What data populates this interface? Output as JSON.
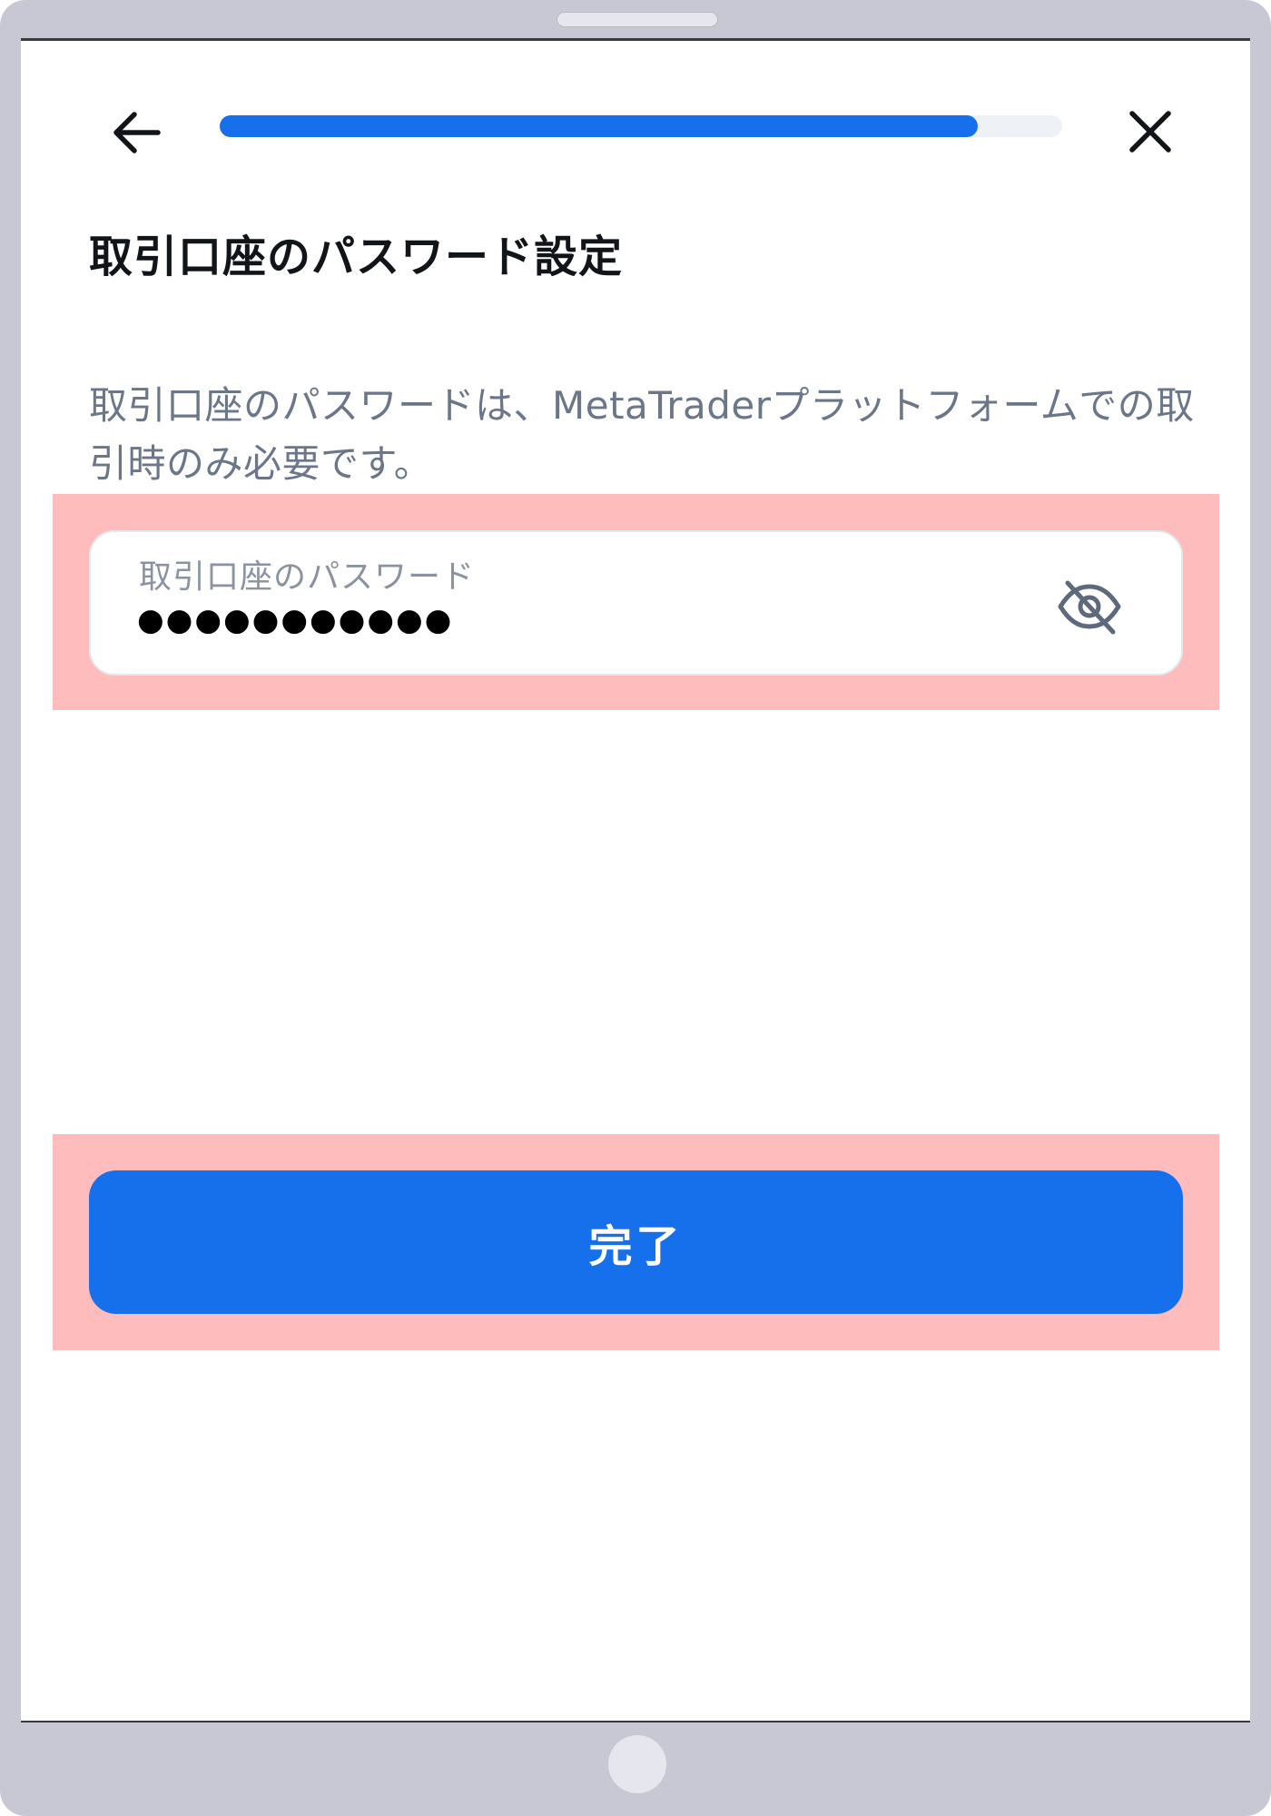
{
  "header": {
    "back_icon": "arrow-left-icon",
    "close_icon": "close-icon",
    "progress": 0.9
  },
  "page": {
    "title": "取引口座のパスワード設定",
    "description": "取引口座のパスワードは、MetaTraderプラットフォームでの取引時のみ必要です。"
  },
  "password_field": {
    "label": "取引口座のパスワード",
    "value": "●●●●●●●●●●●",
    "toggle_icon": "eye-slash-icon"
  },
  "complete_button": {
    "label": "完了"
  },
  "colors": {
    "accent": "#1670ec",
    "highlight": "#ffbcbd",
    "text_primary": "#111418",
    "text_secondary": "#6b7688",
    "device_frame": "#c8c8d4"
  }
}
